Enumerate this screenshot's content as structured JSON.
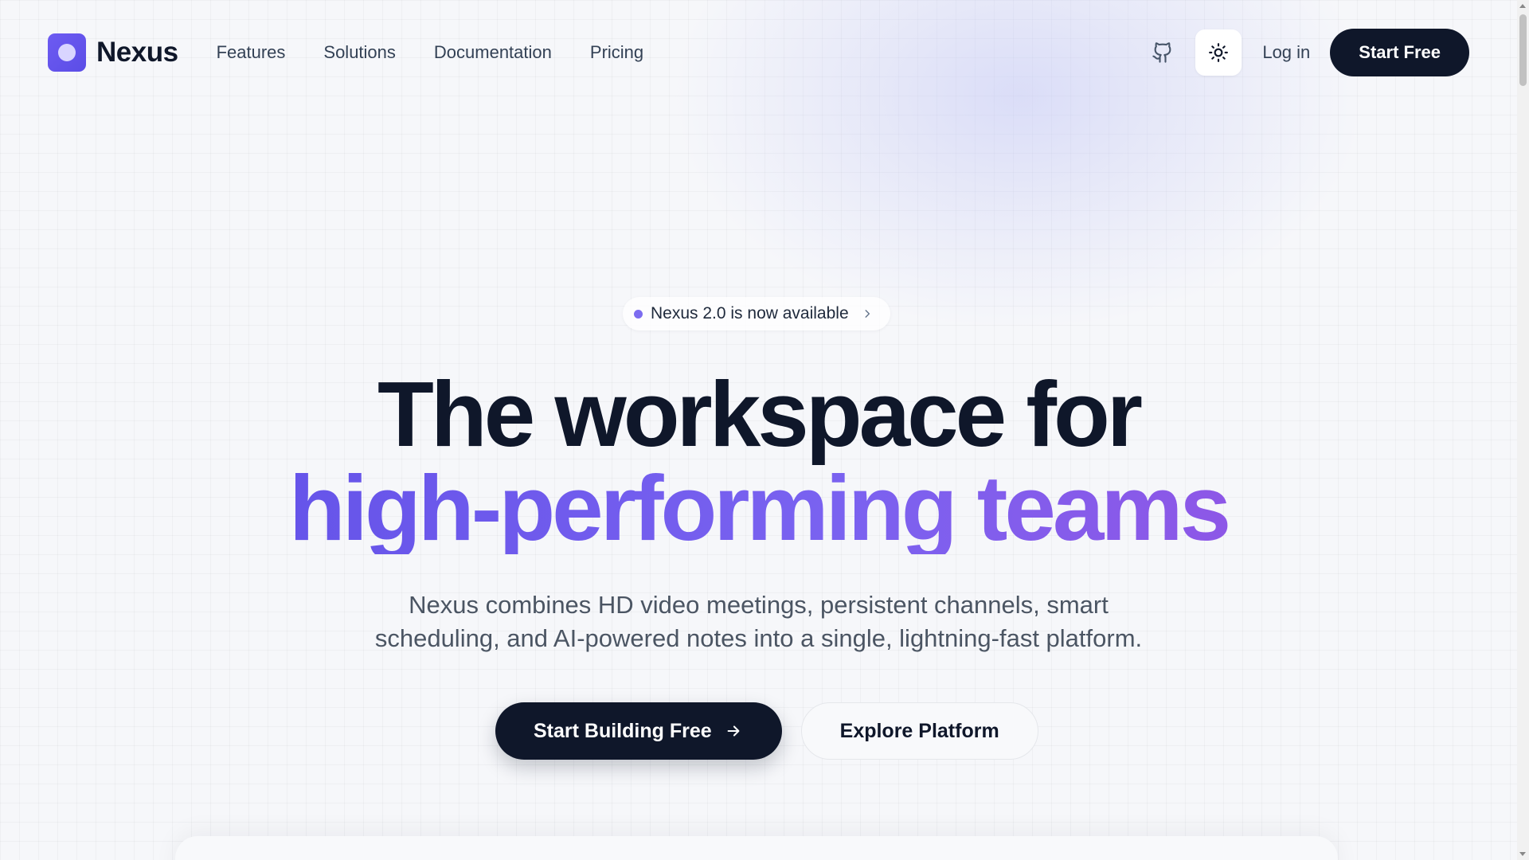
{
  "brand": {
    "name": "Nexus"
  },
  "nav": {
    "links": [
      "Features",
      "Solutions",
      "Documentation",
      "Pricing"
    ],
    "login": "Log in",
    "cta": "Start Free"
  },
  "hero": {
    "badge": "Nexus 2.0 is now available",
    "headline_line1": "The workspace for",
    "headline_line2": "high-performing teams",
    "subtitle_line1": "Nexus combines HD video meetings, persistent channels, smart",
    "subtitle_line2": "scheduling, and AI-powered notes into a single, lightning-fast platform.",
    "primary_cta": "Start Building Free",
    "secondary_cta": "Explore Platform"
  },
  "icons": {
    "github": "github-icon",
    "theme": "sun-icon",
    "arrow": "arrow-right-icon",
    "chevron": "chevron-right-icon"
  },
  "colors": {
    "brand": "#5b4de6",
    "dark": "#0f172a",
    "gradient_end": "#9b4fe0"
  }
}
